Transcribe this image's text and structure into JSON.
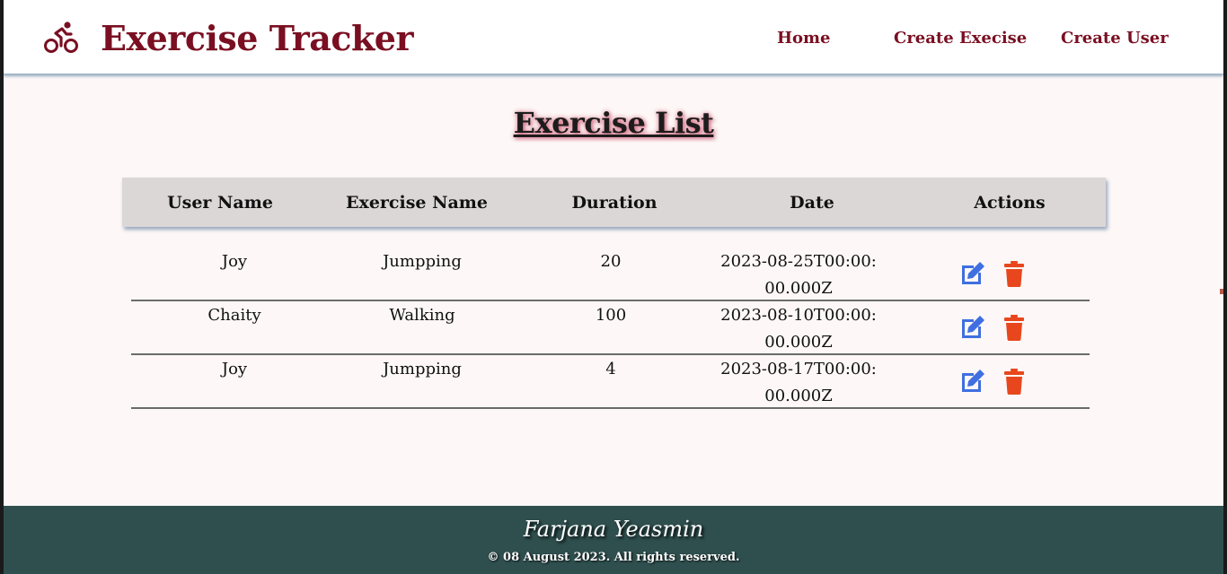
{
  "header": {
    "brand_icon": "bicycle-rider-icon",
    "brand_title": "Exercise Tracker",
    "nav": [
      {
        "label": "Home"
      },
      {
        "label": "Create Execise"
      },
      {
        "label": "Create User"
      }
    ]
  },
  "main": {
    "title": "Exercise List",
    "columns": [
      "User Name",
      "Exercise Name",
      "Duration",
      "Date",
      "Actions"
    ],
    "rows": [
      {
        "username": "Joy",
        "exercise": "Jumpping",
        "duration": "20",
        "date": "2023-08-25T00:00:00.000Z"
      },
      {
        "username": "Chaity",
        "exercise": "Walking",
        "duration": "100",
        "date": "2023-08-10T00:00:00.000Z"
      },
      {
        "username": "Joy",
        "exercise": "Jumpping",
        "duration": "4",
        "date": "2023-08-17T00:00:00.000Z"
      }
    ],
    "actions": {
      "edit_icon": "edit-icon",
      "delete_icon": "trash-icon"
    }
  },
  "footer": {
    "name": "Farjana Yeasmin",
    "copyright": "© 08 August 2023. All rights reserved."
  },
  "colors": {
    "brand": "#7a0f22",
    "header_bg": "#ffffff",
    "page_bg": "#fdf8f7",
    "table_head_bg": "#dcd7d7",
    "edit": "#3f6fe0",
    "delete": "#e8471d",
    "footer_bg": "#2f4f4f"
  }
}
